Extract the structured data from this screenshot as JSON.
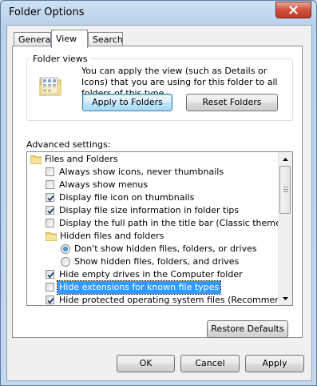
{
  "window": {
    "title": "Folder Options"
  },
  "tabs": [
    {
      "label": "General",
      "active": false
    },
    {
      "label": "View",
      "active": true
    },
    {
      "label": "Search",
      "active": false
    }
  ],
  "folder_views": {
    "legend": "Folder views",
    "description": "You can apply the view (such as Details or Icons) that you are using for this folder to all folders of this type.",
    "apply_label": "Apply to Folders",
    "reset_label": "Reset Folders"
  },
  "advanced": {
    "label": "Advanced settings:",
    "items": [
      {
        "type": "folder",
        "text": "Files and Folders"
      },
      {
        "type": "checkbox",
        "text": "Always show icons, never thumbnails",
        "checked": false
      },
      {
        "type": "checkbox",
        "text": "Always show menus",
        "checked": false
      },
      {
        "type": "checkbox",
        "text": "Display file icon on thumbnails",
        "checked": true
      },
      {
        "type": "checkbox",
        "text": "Display file size information in folder tips",
        "checked": true
      },
      {
        "type": "checkbox",
        "text": "Display the full path in the title bar (Classic theme only)",
        "checked": false
      },
      {
        "type": "folder-sub",
        "text": "Hidden files and folders"
      },
      {
        "type": "radio",
        "text": "Don't show hidden files, folders, or drives",
        "checked": true
      },
      {
        "type": "radio",
        "text": "Show hidden files, folders, and drives",
        "checked": false
      },
      {
        "type": "checkbox",
        "text": "Hide empty drives in the Computer folder",
        "checked": true
      },
      {
        "type": "checkbox",
        "text": "Hide extensions for known file types",
        "checked": false,
        "selected": true
      },
      {
        "type": "checkbox",
        "text": "Hide protected operating system files (Recommended)",
        "checked": true
      }
    ]
  },
  "restore_label": "Restore Defaults",
  "footer": {
    "ok": "OK",
    "cancel": "Cancel",
    "apply": "Apply"
  },
  "colors": {
    "selection": "#3399ff",
    "title_bar": "#c4d8ee",
    "close_button": "#c0392b"
  }
}
